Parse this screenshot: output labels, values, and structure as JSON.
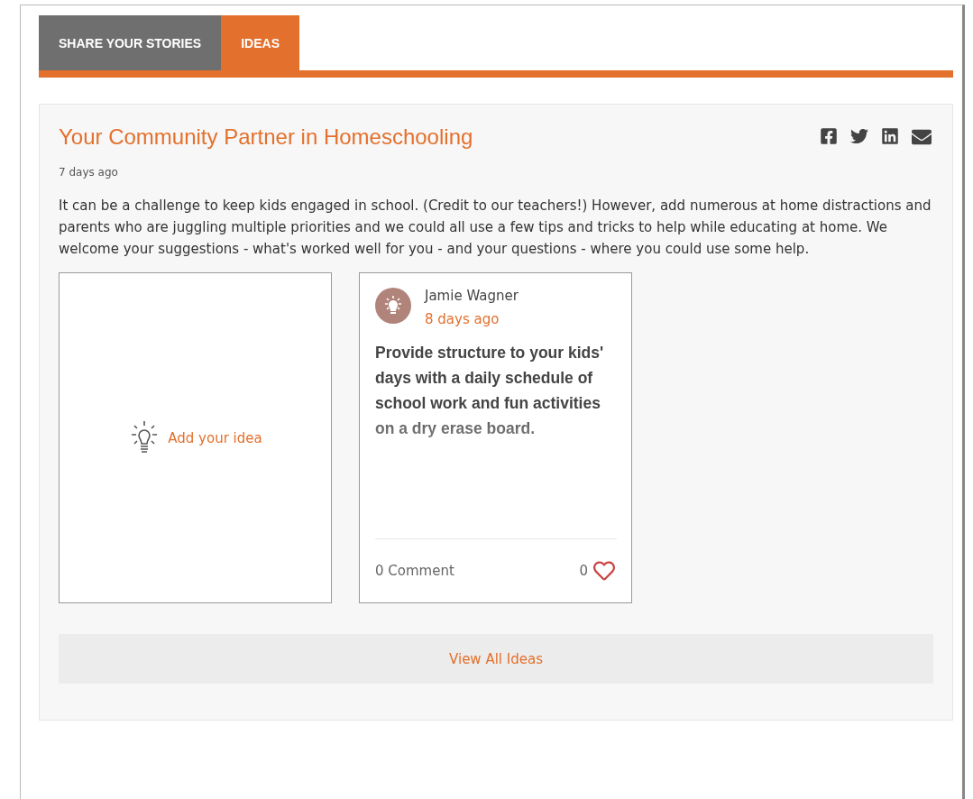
{
  "tabs": [
    {
      "label": "SHARE YOUR STORIES",
      "selected": false
    },
    {
      "label": "IDEAS",
      "selected": true
    }
  ],
  "post": {
    "title": "Your Community Partner in Homeschooling",
    "time": "7 days ago",
    "body": "It can be a challenge to keep kids engaged in school. (Credit to our teachers!) However, add numerous at home distractions and parents who are juggling multiple priorities and we could all use a few tips and tricks to help while educating at home. We welcome your suggestions - what's worked well for you - and your questions - where you could use some help."
  },
  "add_idea": {
    "label": "Add your idea"
  },
  "ideas": [
    {
      "author": "Jamie Wagner",
      "time": "8 days ago",
      "text": "Provide structure to your kids' days with a daily schedule of school work and fun activities on a dry erase board.",
      "comments": "0 Comment",
      "likes": "0",
      "liked": false
    }
  ],
  "view_all": "View All Ideas"
}
